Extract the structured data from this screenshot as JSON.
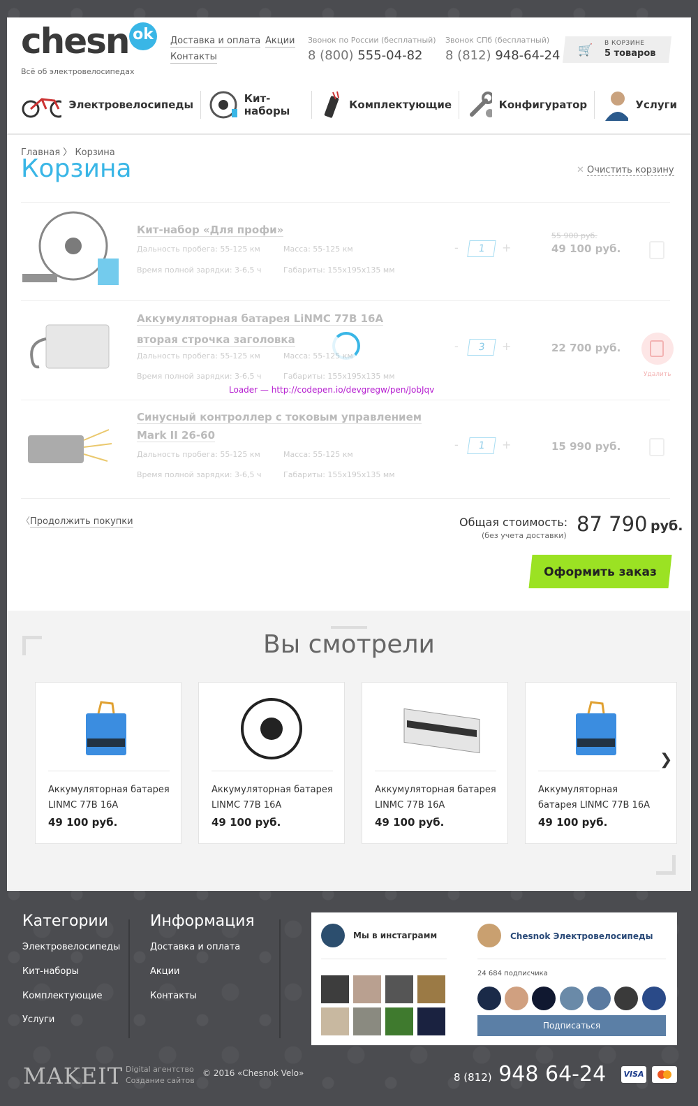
{
  "header": {
    "logo_text": "chesn",
    "logo_badge": "ok",
    "tagline": "Всё об электровелосипедах",
    "links": [
      "Доставка и оплата",
      "Акции",
      "Контакты"
    ],
    "phone1": {
      "caption": "Звонок по России (бесплатный)",
      "prefix": "8 (800)",
      "number": "555-04-82"
    },
    "phone2": {
      "caption": "Звонок СПб (бесплатный)",
      "prefix": "8 (812)",
      "number": "948-64-24"
    },
    "cart": {
      "caption": "В КОРЗИНЕ",
      "count": "5 товаров"
    }
  },
  "nav": [
    "Электровелосипеды",
    "Кит-наборы",
    "Комплектующие",
    "Конфигуратор",
    "Услуги"
  ],
  "breadcrumb": {
    "home": "Главная",
    "sep": "〉",
    "current": "Корзина"
  },
  "page": {
    "title": "Корзина",
    "clear": "Очистить корзину"
  },
  "items": [
    {
      "name": "Кит-набор «Для профи»",
      "name2": "",
      "range": "Дальность пробега: 55-125 км",
      "mass": "Масса: 55-125 км",
      "charge": "Время полной зарядки: 3-6,5 ч",
      "dims": "Габариты: 155х195х135 мм",
      "qty": "1",
      "old_price": "55 900 руб.",
      "price": "49 100 руб."
    },
    {
      "name": "Аккумуляторная батарея LiNMC 77B 16A",
      "name2": "вторая строчка заголовка",
      "range": "Дальность пробега: 55-125 км",
      "mass": "Масса: 55-125 км",
      "charge": "Время полной зарядки: 3-6,5 ч",
      "dims": "Габариты: 155х195х135 мм",
      "qty": "3",
      "old_price": "",
      "price": "22 700 руб.",
      "delete": "Удалить"
    },
    {
      "name": "Синусный контроллер с токовым управлением",
      "name2": "Mark II 26-60",
      "range": "Дальность пробега: 55-125 км",
      "mass": "Масса: 55-125 км",
      "charge": "Время полной зарядки: 3-6,5 ч",
      "dims": "Габариты: 155х195х135 мм",
      "qty": "1",
      "old_price": "",
      "price": "15 990 руб."
    }
  ],
  "loader_note": "Loader — http://codepen.io/devgregw/pen/JobJqv",
  "summary": {
    "continue": "Продолжить покупки",
    "total_label": "Общая стоимость:",
    "total_note": "(без учета доставки)",
    "total_value": "87 790",
    "currency": "руб.",
    "order_button": "Оформить заказ"
  },
  "seen": {
    "title": "Вы смотрели",
    "tiles": [
      {
        "name": "Аккумуляторная батарея LINMC 77B 16A",
        "price": "49 100 руб."
      },
      {
        "name": "Аккумуляторная батарея LINMC 77B 16A",
        "price": "49 100 руб."
      },
      {
        "name": "Аккумуляторная батарея LINMC 77B 16A",
        "price": "49 100 руб."
      },
      {
        "name": "Аккумуляторная батарея LINMC 77B 16A",
        "price": "49 100 руб."
      }
    ]
  },
  "footer": {
    "cat_title": "Категории",
    "cats": [
      "Электровелосипеды",
      "Кит-наборы",
      "Комплектующие",
      "Услуги"
    ],
    "info_title": "Информация",
    "info": [
      "Доставка и оплата",
      "Акции",
      "Контакты"
    ],
    "instagram_title": "Мы в инстаграмм",
    "vk": {
      "title": "Chesnok Электровелосипеды",
      "subs": "24 684 подписчика",
      "button": "Подписаться"
    },
    "makeit": "MAKEIT",
    "makeit_sub1": "Digital агентство",
    "makeit_sub2": "Создание сайтов",
    "copyright": "© 2016 «Chesnok Velo»",
    "phone_prefix": "8 (812)",
    "phone": "948 64-24",
    "visa": "VISA",
    "mc": "MasterCard"
  },
  "colors": {
    "accent": "#39b6e6",
    "order": "#9be223",
    "footer_bg": "#4b4c50"
  }
}
